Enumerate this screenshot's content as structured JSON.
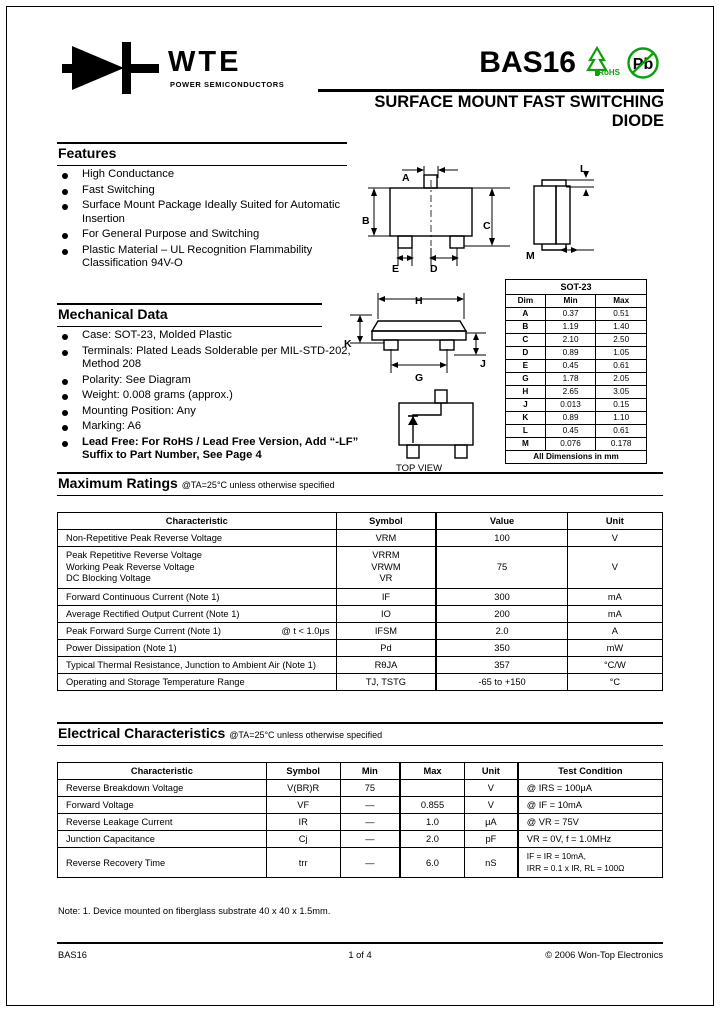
{
  "document": {
    "part_number": "BAS16",
    "subtitle": "SURFACE MOUNT FAST SWITCHING DIODE",
    "logo_text": "WTE",
    "logo_tagline": "POWER SEMICONDUCTORS",
    "rohs_label": "RoHS",
    "pb_label": "Pb"
  },
  "features": {
    "heading": "Features",
    "items": [
      "High Conductance",
      "Fast Switching",
      "Surface Mount Package Ideally Suited for Automatic Insertion",
      "For General Purpose and Switching",
      "Plastic Material – UL Recognition Flammability Classification 94V-O"
    ]
  },
  "mechanical": {
    "heading": "Mechanical Data",
    "items": [
      "Case: SOT-23, Molded Plastic",
      "Terminals: Plated Leads Solderable per MIL-STD-202, Method 208",
      "Polarity: See Diagram",
      "Weight: 0.008 grams (approx.)",
      "Mounting Position: Any",
      "Marking: A6",
      "Lead Free: For RoHS / Lead Free Version, Add “-LF” Suffix to Part Number, See Page 4"
    ]
  },
  "package": {
    "title": "SOT-23",
    "top_view_label": "TOP VIEW",
    "footer": "All Dimensions in mm",
    "columns": [
      "Dim",
      "Min",
      "Max"
    ],
    "rows": [
      {
        "dim": "A",
        "min": "0.37",
        "max": "0.51"
      },
      {
        "dim": "B",
        "min": "1.19",
        "max": "1.40"
      },
      {
        "dim": "C",
        "min": "2.10",
        "max": "2.50"
      },
      {
        "dim": "D",
        "min": "0.89",
        "max": "1.05"
      },
      {
        "dim": "E",
        "min": "0.45",
        "max": "0.61"
      },
      {
        "dim": "G",
        "min": "1.78",
        "max": "2.05"
      },
      {
        "dim": "H",
        "min": "2.65",
        "max": "3.05"
      },
      {
        "dim": "J",
        "min": "0.013",
        "max": "0.15"
      },
      {
        "dim": "K",
        "min": "0.89",
        "max": "1.10"
      },
      {
        "dim": "L",
        "min": "0.45",
        "max": "0.61"
      },
      {
        "dim": "M",
        "min": "0.076",
        "max": "0.178"
      }
    ],
    "drawing_labels": {
      "a": "A",
      "b": "B",
      "c": "C",
      "d": "D",
      "e": "E",
      "g": "G",
      "h": "H",
      "j": "J",
      "k": "K",
      "l": "L",
      "m": "M"
    }
  },
  "max_ratings": {
    "heading": "Maximum Ratings",
    "subheading": "@TA=25°C unless otherwise specified",
    "columns": [
      "Characteristic",
      "Symbol",
      "Value",
      "Unit"
    ],
    "rows": [
      {
        "characteristic": "Non-Repetitive Peak Reverse Voltage",
        "condition": "",
        "symbol": "VRM",
        "value": "100",
        "unit": "V"
      },
      {
        "characteristic": "Peak Repetitive Reverse Voltage\nWorking Peak Reverse Voltage\nDC Blocking Voltage",
        "condition": "",
        "symbol": "VRRM\nVRWM\nVR",
        "value": "75",
        "unit": "V"
      },
      {
        "characteristic": "Forward Continuous Current (Note 1)",
        "condition": "",
        "symbol": "IF",
        "value": "300",
        "unit": "mA"
      },
      {
        "characteristic": "Average Rectified Output Current (Note 1)",
        "condition": "",
        "symbol": "IO",
        "value": "200",
        "unit": "mA"
      },
      {
        "characteristic": "Peak Forward Surge Current (Note 1)",
        "condition": "@ t < 1.0μs",
        "symbol": "IFSM",
        "value": "2.0",
        "unit": "A"
      },
      {
        "characteristic": "Power Dissipation (Note 1)",
        "condition": "",
        "symbol": "Pd",
        "value": "350",
        "unit": "mW"
      },
      {
        "characteristic": "Typical Thermal Resistance, Junction to Ambient Air (Note 1)",
        "condition": "",
        "symbol": "RθJA",
        "value": "357",
        "unit": "°C/W"
      },
      {
        "characteristic": "Operating and Storage Temperature Range",
        "condition": "",
        "symbol": "TJ, TSTG",
        "value": "-65 to +150",
        "unit": "°C"
      }
    ]
  },
  "electrical": {
    "heading": "Electrical Characteristics",
    "subheading": "@TA=25°C unless otherwise specified",
    "columns": [
      "Characteristic",
      "Symbol",
      "Min",
      "Max",
      "Unit",
      "Test Condition"
    ],
    "rows": [
      {
        "characteristic": "Reverse Breakdown Voltage",
        "symbol": "V(BR)R",
        "min": "75",
        "max": "",
        "unit": "V",
        "test": "@ IRS = 100μA"
      },
      {
        "characteristic": "Forward Voltage",
        "symbol": "VF",
        "min": "—",
        "max": "0.855",
        "unit": "V",
        "test": "@ IF = 10mA"
      },
      {
        "characteristic": "Reverse Leakage Current",
        "symbol": "IR",
        "min": "—",
        "max": "1.0",
        "unit": "μA",
        "test": "@ VR = 75V"
      },
      {
        "characteristic": "Junction Capacitance",
        "symbol": "Cj",
        "min": "—",
        "max": "2.0",
        "unit": "pF",
        "test": "VR = 0V, f = 1.0MHz"
      },
      {
        "characteristic": "Reverse Recovery Time",
        "symbol": "trr",
        "min": "—",
        "max": "6.0",
        "unit": "nS",
        "test": "IF = IR = 10mA,\nIRR = 0.1 x IR, RL = 100Ω"
      }
    ]
  },
  "note": "Note:  1. Device mounted on fiberglass substrate 40 x 40 x 1.5mm.",
  "footer": {
    "left": "BAS16",
    "center": "1 of 4",
    "right": "© 2006 Won-Top Electronics"
  },
  "colors": {
    "rohs_green": "#0aa00a",
    "text": "#000000",
    "page_bg": "#ffffff"
  }
}
